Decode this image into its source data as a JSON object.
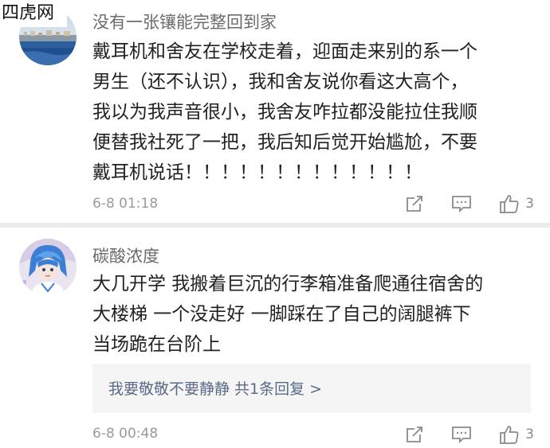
{
  "watermark": "四虎网",
  "comments": [
    {
      "username": "没有一张镶能完整回到家",
      "lines": [
        "戴耳机和舍友在学校走着，迎面走来别的系一个",
        "男生（还不认识），我和舍友说你看这大高个，",
        "我以为我声音很小，我舍友咋拉都没能拉住我顺",
        "便替我社死了一把，我后知后觉开始尴尬，不要",
        "戴耳机说话！！！！！！！！！！！！！"
      ],
      "time": "6-8 01:18",
      "likes": "3",
      "icons": {
        "avatar": "avatar-coastal-landscape",
        "forward": "forward-icon",
        "reply": "comment-icon",
        "like": "thumbs-up-icon"
      }
    },
    {
      "username": "碳酸浓度",
      "lines": [
        "大几开学 我搬着巨沉的行李箱准备爬通往宿舍的",
        "大楼梯 一个没走好 一脚踩在了自己的阔腿裤下",
        "当场跪在台阶上"
      ],
      "reply_link": "我要敬敬不要静静  共1条回复 >",
      "time": "6-8 00:48",
      "likes": "3",
      "icons": {
        "avatar": "avatar-anime-character",
        "forward": "forward-icon",
        "reply": "comment-icon",
        "like": "thumbs-up-icon"
      }
    }
  ],
  "colors": {
    "username": "#6b6b6b",
    "body_text": "#222222",
    "meta_text": "#9a9a9a",
    "reply_link": "#5a6a88",
    "divider": "#ececec",
    "reply_box_bg": "#f5f5f5"
  }
}
